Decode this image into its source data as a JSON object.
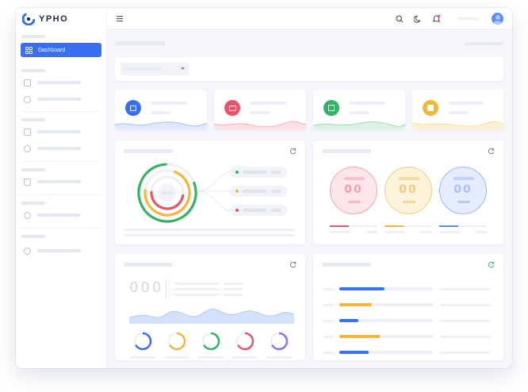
{
  "app": {
    "logo_text": "YPHO",
    "brand_color": "#3a6ff2"
  },
  "sidebar": {
    "active_item_label": "Dashboard"
  },
  "widgets": {
    "bubbles": [
      {
        "value": "00",
        "color": "#e8546a"
      },
      {
        "value": "00",
        "color": "#e8b83a"
      },
      {
        "value": "00",
        "color": "#5b8ff0"
      }
    ],
    "counter": {
      "value": "000"
    }
  },
  "colors": {
    "red": "#e8546a",
    "yellow": "#f2b73c",
    "green": "#35b364",
    "blue": "#3a6ff2",
    "purple": "#9470d8"
  },
  "icons": [
    "menu-icon",
    "search-icon",
    "moon-icon",
    "bell-icon",
    "avatar",
    "refresh-icon",
    "dashboard-icon"
  ]
}
